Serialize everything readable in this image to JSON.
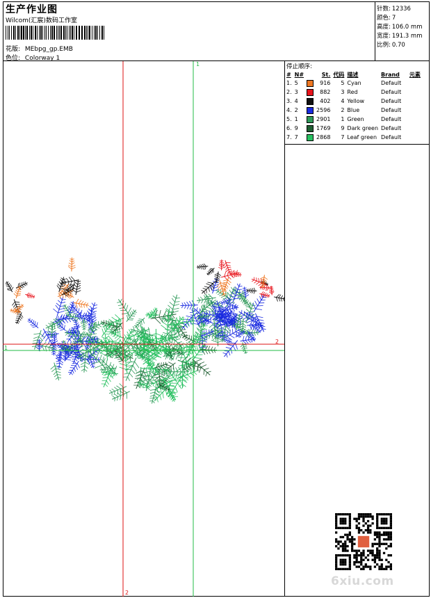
{
  "header": {
    "title": "生产作业图",
    "subtitle": "Wilcom(汇宸)数码工作室",
    "design_label": "花版:",
    "design_value": "MEbpg_gp.EMB",
    "colorway_label": "色位:",
    "colorway_value": "Colorway 1"
  },
  "stats": [
    {
      "label": "针数:",
      "value": "12336"
    },
    {
      "label": "颜色:",
      "value": "7"
    },
    {
      "label": "高度:",
      "value": "106.0 mm"
    },
    {
      "label": "宽度:",
      "value": "191.3 mm"
    },
    {
      "label": "比例:",
      "value": "0.70"
    }
  ],
  "legend": {
    "title": "停止顺序:",
    "columns": [
      "#",
      "N#",
      "St.",
      "代码",
      "描述",
      "Brand",
      "元素"
    ],
    "rows": [
      {
        "seq": "1.",
        "n": "5",
        "color": "#ee7722",
        "st": "916",
        "code": "5",
        "desc": "Cyan",
        "brand": "Default"
      },
      {
        "seq": "2.",
        "n": "3",
        "color": "#e8141c",
        "st": "882",
        "code": "3",
        "desc": "Red",
        "brand": "Default"
      },
      {
        "seq": "3.",
        "n": "4",
        "color": "#111111",
        "st": "402",
        "code": "4",
        "desc": "Yellow",
        "brand": "Default"
      },
      {
        "seq": "4.",
        "n": "2",
        "color": "#1a2be0",
        "st": "2596",
        "code": "2",
        "desc": "Blue",
        "brand": "Default"
      },
      {
        "seq": "5.",
        "n": "1",
        "color": "#2f9a5a",
        "st": "2901",
        "code": "1",
        "desc": "Green",
        "brand": "Default"
      },
      {
        "seq": "6.",
        "n": "9",
        "color": "#1f5e32",
        "st": "1769",
        "code": "9",
        "desc": "Dark green",
        "brand": "Default"
      },
      {
        "seq": "7.",
        "n": "7",
        "color": "#27c060",
        "st": "2868",
        "code": "7",
        "desc": "Leaf green",
        "brand": "Default"
      }
    ]
  },
  "axes": {
    "green_top": "1",
    "green_left": "1",
    "red_right": "2",
    "red_bottom": "2"
  },
  "watermark": "6xiu.com"
}
